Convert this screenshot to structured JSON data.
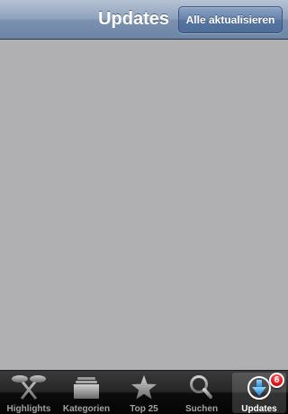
{
  "navbar": {
    "title": "Updates",
    "right_button_label": "Alle aktualisieren"
  },
  "tabbar": {
    "selected": "Updates",
    "items": [
      {
        "label": "Highlights",
        "icon": "highlights-icon"
      },
      {
        "label": "Kategorien",
        "icon": "categories-icon"
      },
      {
        "label": "Top 25",
        "icon": "star-icon"
      },
      {
        "label": "Suchen",
        "icon": "search-icon"
      },
      {
        "label": "Updates",
        "icon": "download-icon",
        "badge": "6"
      }
    ]
  },
  "colors": {
    "navbar_tint": "#7a91b0",
    "content_background": "#b0b0b2",
    "tabbar_background": "#0c0c0c",
    "selected_icon": "#2f9ef0",
    "badge": "#e3121b"
  }
}
